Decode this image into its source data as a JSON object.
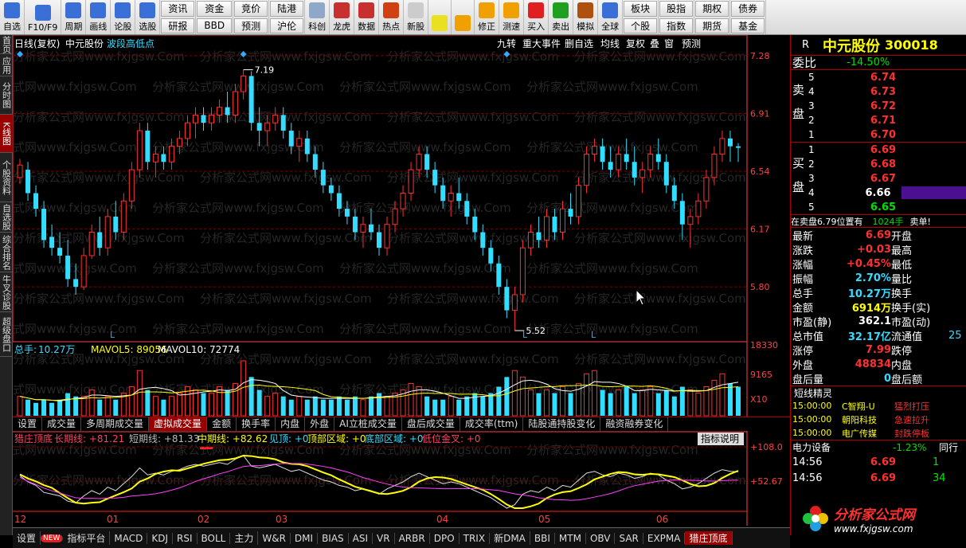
{
  "toolbar": {
    "buttons": [
      {
        "label": "自选",
        "icon": "star-icon",
        "color": "#3a6fd8"
      },
      {
        "label": "F10/F9",
        "icon": "info-icon",
        "color": "#3a6fd8"
      },
      {
        "label": "周期",
        "icon": "clock-icon",
        "color": "#3a6fd8"
      },
      {
        "label": "画线",
        "icon": "pencil-icon",
        "color": "#3a6fd8"
      },
      {
        "label": "论股",
        "icon": "talk-icon",
        "color": "#3a6fd8"
      },
      {
        "label": "选股",
        "icon": "select-icon",
        "color": "#3a6fd8"
      }
    ],
    "grid": [
      [
        "资讯",
        "研报"
      ],
      [
        "资金",
        "BBD"
      ],
      [
        "竞价",
        "预测"
      ],
      [
        "陆港",
        "沪伦"
      ]
    ],
    "buttons2": [
      {
        "label": "科创",
        "icon": "chart-icon",
        "color": "#8fa7c9"
      },
      {
        "label": "龙虎",
        "icon": "dragon-icon",
        "color": "#c83030"
      },
      {
        "label": "数据",
        "icon": "pe-icon",
        "color": "#c83030"
      },
      {
        "label": "热点",
        "icon": "hot-icon",
        "color": "#d04010"
      },
      {
        "label": "新股",
        "icon": "doc-icon",
        "color": "#cccccc"
      }
    ],
    "buttons3": [
      {
        "label": "",
        "icon": "grid-icon",
        "color": "#e8e020"
      },
      {
        "label": "",
        "icon": "back-arrow-icon",
        "color": "#f0a000"
      },
      {
        "label": "修正",
        "icon": "up-down-icon",
        "color": "#f0a000"
      },
      {
        "label": "测速",
        "icon": "speed-icon",
        "color": "#f0a000"
      },
      {
        "label": "买入",
        "icon": "buy-icon",
        "color": "#e02020"
      },
      {
        "label": "卖出",
        "icon": "sell-icon",
        "color": "#20a020"
      },
      {
        "label": "模拟",
        "icon": "hammer-icon",
        "color": "#b05010"
      },
      {
        "label": "全球",
        "icon": "globe-icon",
        "color": "#3a6fd8"
      }
    ],
    "grid2": [
      [
        "板块",
        "个股"
      ],
      [
        "股指",
        "指数"
      ],
      [
        "期权",
        "期货"
      ],
      [
        "债券",
        "基金"
      ]
    ]
  },
  "lefttabs": [
    "首页",
    "应用",
    "分时图",
    "K线图",
    "个股资料",
    "自选股",
    "综合排名",
    "牛叉诊股",
    "超级盘口"
  ],
  "chart_header": {
    "title": "日线(复权)",
    "stock": "中元股份",
    "indicator": "波段高低点",
    "buttons": [
      "九转",
      "重大事件",
      "删自选",
      "均线",
      "复权",
      "叠",
      "窗",
      "预测"
    ]
  },
  "price_axis": [
    "7.28",
    "6.91",
    "6.54",
    "6.17",
    "5.80"
  ],
  "annotations": {
    "high": "7.19",
    "low": "5.52"
  },
  "volume_header": {
    "label": "总手:",
    "total": "10.27万",
    "ma5": "MAVOL5: 89056",
    "ma10": "MAVOL10: 72774"
  },
  "volume_axis": [
    "18330",
    "9165",
    "X10"
  ],
  "subtabs": [
    "设置",
    "成交量",
    "多周期成交量",
    "虚拟成交量",
    "金额",
    "换手率",
    "内盘",
    "外盘",
    "AI立桩成交量",
    "盘后成交量",
    "成交率(ttm)",
    "陆股通持股变化",
    "融资融券变化"
  ],
  "indicator_header": {
    "name": "猎庄顶底",
    "long": "长期线: +81.21",
    "short": "短期线: +81.33",
    "mid": "中期线: +82.62",
    "top": "见顶: +0",
    "topzone": "顶部区域: +0",
    "bottomzone": "底部区域: +0",
    "lowgold": "低位金叉: +0",
    "help": "指标说明"
  },
  "indicator_axis": [
    "+108.0",
    "+52.67"
  ],
  "months": [
    "12",
    "01",
    "02",
    "03",
    "04",
    "05",
    "06"
  ],
  "bottomtabs": [
    "设置",
    "NEW",
    "指标平台",
    "MACD",
    "KDJ",
    "RSI",
    "BOLL",
    "主力",
    "W&R",
    "DMI",
    "BIAS",
    "ASI",
    "VR",
    "ARBR",
    "DPO",
    "TRIX",
    "新DMA",
    "BBI",
    "MTM",
    "OBV",
    "SAR",
    "EXPMA",
    "猎庄顶底"
  ],
  "quote": {
    "r": "R",
    "name": "中元股份",
    "code": "300018",
    "webi_label": "委比",
    "webi": "-14.50%",
    "sell_label": "卖盘",
    "buy_label": "买盘",
    "asks": [
      [
        "5",
        "6.74"
      ],
      [
        "4",
        "6.73"
      ],
      [
        "3",
        "6.72"
      ],
      [
        "2",
        "6.71"
      ],
      [
        "1",
        "6.70"
      ]
    ],
    "bids": [
      [
        "1",
        "6.69"
      ],
      [
        "2",
        "6.68"
      ],
      [
        "3",
        "6.67"
      ],
      [
        "4",
        "6.66"
      ],
      [
        "5",
        "6.65"
      ]
    ],
    "notice": "在卖盘6.79位置有",
    "notice_vol": "1024手",
    "notice_tag": "卖单!",
    "stats": [
      [
        "最新",
        "6.69",
        "开盘",
        ""
      ],
      [
        "涨跌",
        "+0.03",
        "最高",
        ""
      ],
      [
        "涨幅",
        "+0.45%",
        "最低",
        ""
      ],
      [
        "振幅",
        "2.70%",
        "量比",
        ""
      ],
      [
        "总手",
        "10.27万",
        "换手",
        ""
      ],
      [
        "金额",
        "6914万",
        "换手(实)",
        ""
      ],
      [
        "市盈(静)",
        "362.1",
        "市盈(动)",
        ""
      ],
      [
        "总市值",
        "32.17亿",
        "流通值",
        "25"
      ],
      [
        "涨停",
        "7.99",
        "跌停",
        ""
      ],
      [
        "外盘",
        "48834",
        "内盘",
        ""
      ],
      [
        "盘后量",
        "0",
        "盘后额",
        ""
      ]
    ],
    "news_title": "短线精灵",
    "news": [
      [
        "15:00:00",
        "C智翔-U",
        "猛烈打压"
      ],
      [
        "15:00:00",
        "朝阳科技",
        "急速拉升"
      ],
      [
        "15:00:00",
        "电广传媒",
        "封跌停板"
      ]
    ],
    "sector": "电力设备",
    "sector_chg": "-1.23%",
    "sector_more": "同行",
    "ticks": [
      [
        "14:56",
        "6.69",
        "1"
      ],
      [
        "14:56",
        "6.69",
        "34"
      ]
    ]
  },
  "watermark": "分析家公式网www.fxjgsw.Com",
  "logo": {
    "text": "分析家公式网",
    "url": "www.fxjgsw.com"
  },
  "colors": {
    "up": "#ff3030",
    "down": "#33ddff",
    "grid": "#7a0000",
    "axis": "#ff4040"
  },
  "chart_data": {
    "type": "candlestick",
    "ylim": [
      5.5,
      7.3
    ],
    "ohlc": [
      [
        6.5,
        6.62,
        6.46,
        6.58
      ],
      [
        6.55,
        6.6,
        6.35,
        6.4
      ],
      [
        6.4,
        6.45,
        6.25,
        6.3
      ],
      [
        6.3,
        6.35,
        6.05,
        6.1
      ],
      [
        6.12,
        6.2,
        6.0,
        6.05
      ],
      [
        6.05,
        6.15,
        5.95,
        6.0
      ],
      [
        6.0,
        6.1,
        5.8,
        5.85
      ],
      [
        5.85,
        5.95,
        5.75,
        5.8
      ],
      [
        5.8,
        6.05,
        5.78,
        6.0
      ],
      [
        6.0,
        6.2,
        5.98,
        6.15
      ],
      [
        6.15,
        6.25,
        6.0,
        6.05
      ],
      [
        6.05,
        6.3,
        6.0,
        6.25
      ],
      [
        6.25,
        6.35,
        6.1,
        6.15
      ],
      [
        6.15,
        6.4,
        6.1,
        6.35
      ],
      [
        6.35,
        6.6,
        6.3,
        6.55
      ],
      [
        6.55,
        6.85,
        6.5,
        6.8
      ],
      [
        6.8,
        6.85,
        6.55,
        6.6
      ],
      [
        6.6,
        6.7,
        6.5,
        6.65
      ],
      [
        6.65,
        6.7,
        6.55,
        6.6
      ],
      [
        6.6,
        6.75,
        6.55,
        6.7
      ],
      [
        6.7,
        6.8,
        6.65,
        6.75
      ],
      [
        6.75,
        6.9,
        6.7,
        6.85
      ],
      [
        6.85,
        6.95,
        6.75,
        6.9
      ],
      [
        6.9,
        6.95,
        6.8,
        6.85
      ],
      [
        6.85,
        6.95,
        6.8,
        6.9
      ],
      [
        6.9,
        7.0,
        6.85,
        6.95
      ],
      [
        6.95,
        7.05,
        6.85,
        6.9
      ],
      [
        6.9,
        7.1,
        6.85,
        7.05
      ],
      [
        7.05,
        7.19,
        7.0,
        7.15
      ],
      [
        7.15,
        7.18,
        6.8,
        6.85
      ],
      [
        6.85,
        6.95,
        6.7,
        6.8
      ],
      [
        6.8,
        6.9,
        6.7,
        6.85
      ],
      [
        6.85,
        6.95,
        6.8,
        6.9
      ],
      [
        6.9,
        6.95,
        6.75,
        6.8
      ],
      [
        6.8,
        6.85,
        6.65,
        6.7
      ],
      [
        6.7,
        6.8,
        6.6,
        6.75
      ],
      [
        6.75,
        6.8,
        6.6,
        6.65
      ],
      [
        6.65,
        6.7,
        6.5,
        6.55
      ],
      [
        6.55,
        6.6,
        6.4,
        6.45
      ],
      [
        6.45,
        6.5,
        6.35,
        6.4
      ],
      [
        6.4,
        6.45,
        6.25,
        6.3
      ],
      [
        6.3,
        6.35,
        6.2,
        6.25
      ],
      [
        6.25,
        6.3,
        6.1,
        6.15
      ],
      [
        6.15,
        6.25,
        6.05,
        6.2
      ],
      [
        6.2,
        6.3,
        6.1,
        6.15
      ],
      [
        6.15,
        6.2,
        6.0,
        6.05
      ],
      [
        6.05,
        6.25,
        6.0,
        6.2
      ],
      [
        6.2,
        6.35,
        6.15,
        6.3
      ],
      [
        6.3,
        6.45,
        6.25,
        6.4
      ],
      [
        6.4,
        6.6,
        6.35,
        6.55
      ],
      [
        6.55,
        6.7,
        6.5,
        6.65
      ],
      [
        6.65,
        6.7,
        6.5,
        6.55
      ],
      [
        6.55,
        6.6,
        6.4,
        6.45
      ],
      [
        6.45,
        6.5,
        6.3,
        6.35
      ],
      [
        6.35,
        6.45,
        6.25,
        6.4
      ],
      [
        6.4,
        6.5,
        6.3,
        6.35
      ],
      [
        6.35,
        6.4,
        6.2,
        6.25
      ],
      [
        6.25,
        6.3,
        6.1,
        6.15
      ],
      [
        6.15,
        6.2,
        6.0,
        6.05
      ],
      [
        6.05,
        6.1,
        5.9,
        5.95
      ],
      [
        5.95,
        6.0,
        5.75,
        5.8
      ],
      [
        5.8,
        5.85,
        5.6,
        5.65
      ],
      [
        5.65,
        5.8,
        5.52,
        5.75
      ],
      [
        5.75,
        6.1,
        5.7,
        6.05
      ],
      [
        6.05,
        6.2,
        6.0,
        6.15
      ],
      [
        6.15,
        6.25,
        6.05,
        6.1
      ],
      [
        6.1,
        6.3,
        6.05,
        6.25
      ],
      [
        6.25,
        6.3,
        6.1,
        6.15
      ],
      [
        6.15,
        6.35,
        6.1,
        6.3
      ],
      [
        6.3,
        6.4,
        6.2,
        6.25
      ],
      [
        6.25,
        6.5,
        6.2,
        6.45
      ],
      [
        6.45,
        6.7,
        6.4,
        6.65
      ],
      [
        6.65,
        6.75,
        6.6,
        6.7
      ],
      [
        6.7,
        6.75,
        6.55,
        6.6
      ],
      [
        6.6,
        6.7,
        6.5,
        6.55
      ],
      [
        6.55,
        6.7,
        6.5,
        6.65
      ],
      [
        6.65,
        6.75,
        6.55,
        6.6
      ],
      [
        6.6,
        6.7,
        6.45,
        6.5
      ],
      [
        6.5,
        6.6,
        6.4,
        6.55
      ],
      [
        6.55,
        6.7,
        6.5,
        6.65
      ],
      [
        6.65,
        6.75,
        6.55,
        6.6
      ],
      [
        6.6,
        6.65,
        6.4,
        6.45
      ],
      [
        6.45,
        6.5,
        6.3,
        6.35
      ],
      [
        6.35,
        6.4,
        6.1,
        6.2
      ],
      [
        6.2,
        6.3,
        6.05,
        6.25
      ],
      [
        6.25,
        6.4,
        6.2,
        6.35
      ],
      [
        6.35,
        6.55,
        6.3,
        6.5
      ],
      [
        6.5,
        6.7,
        6.45,
        6.65
      ],
      [
        6.65,
        6.8,
        6.6,
        6.75
      ],
      [
        6.75,
        6.8,
        6.6,
        6.7
      ],
      [
        6.7,
        6.72,
        6.6,
        6.69
      ]
    ],
    "volume": [
      6,
      5,
      4,
      5,
      4,
      5,
      7,
      6,
      6,
      8,
      5,
      6,
      5,
      7,
      9,
      14,
      8,
      6,
      5,
      6,
      7,
      9,
      8,
      7,
      7,
      9,
      8,
      10,
      17,
      12,
      8,
      6,
      7,
      6,
      5,
      6,
      5,
      6,
      5,
      5,
      6,
      5,
      6,
      5,
      6,
      7,
      6,
      7,
      8,
      10,
      9,
      6,
      5,
      5,
      6,
      5,
      6,
      7,
      6,
      7,
      9,
      12,
      14,
      12,
      8,
      7,
      8,
      7,
      9,
      7,
      10,
      13,
      14,
      8,
      7,
      8,
      9,
      7,
      8,
      9,
      7,
      8,
      6,
      9,
      8,
      7,
      9,
      11,
      13,
      10,
      9
    ]
  }
}
